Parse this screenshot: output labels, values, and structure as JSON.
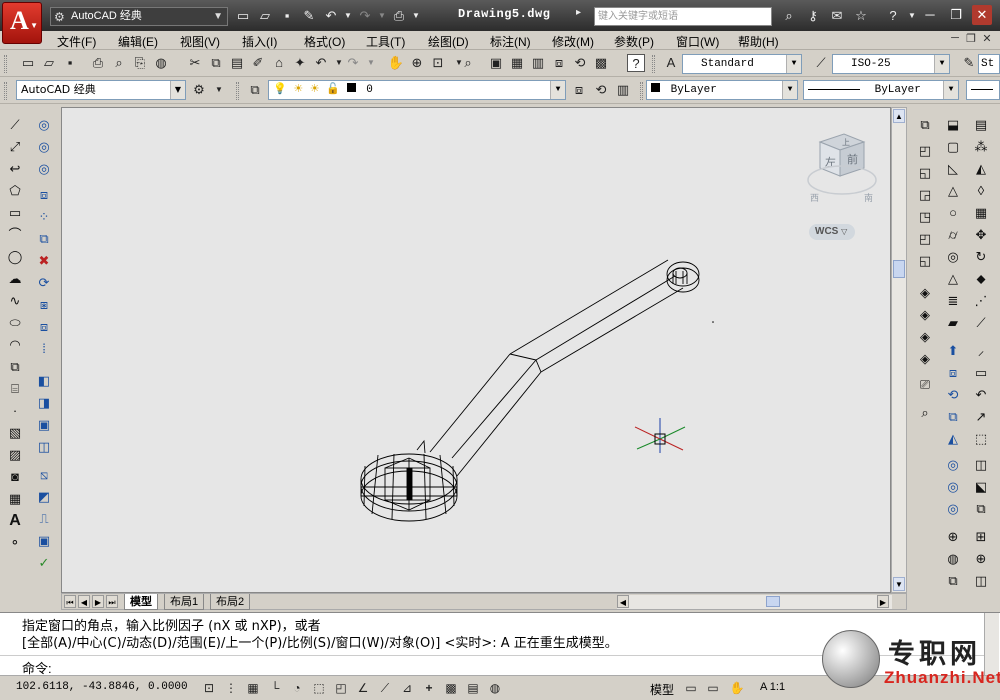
{
  "titlebar": {
    "app_logo": "A",
    "workspace": "AutoCAD 经典",
    "document_title": "Drawing5.dwg",
    "search_placeholder": "键入关键字或短语"
  },
  "menu": [
    "文件(F)",
    "编辑(E)",
    "视图(V)",
    "插入(I)",
    "格式(O)",
    "工具(T)",
    "绘图(D)",
    "标注(N)",
    "修改(M)",
    "参数(P)",
    "窗口(W)",
    "帮助(H)"
  ],
  "styles": {
    "text_style": "Standard",
    "dim_style": "ISO-25",
    "extra": "St"
  },
  "layers": {
    "workspace": "AutoCAD 经典",
    "layer_name": "0",
    "color": "ByLayer",
    "linetype": "ByLayer"
  },
  "viewcube": {
    "top_label": "上",
    "front_label": "左",
    "right_label": "前",
    "left_dir": "西",
    "right_dir": "南",
    "wcs": "WCS"
  },
  "tabs": [
    "模型",
    "布局1",
    "布局2"
  ],
  "command": {
    "line1": "指定窗口的角点，输入比例因子 (nX 或 nXP)，或者",
    "line2": "[全部(A)/中心(C)/动态(D)/范围(E)/上一个(P)/比例(S)/窗口(W)/对象(O)] <实时>: A 正在重生成模型。",
    "prompt": "命令:"
  },
  "status": {
    "coords": "102.6118, -43.8846, 0.0000",
    "model": "模型",
    "scale": "A 1:1"
  },
  "watermark": {
    "zh": "专职网",
    "en": "Zhuanzhi.Net"
  },
  "colors": {
    "titlebar": "#3a3a3a",
    "canvas": "#e6e6e6",
    "logo_red": "#d8261f"
  }
}
